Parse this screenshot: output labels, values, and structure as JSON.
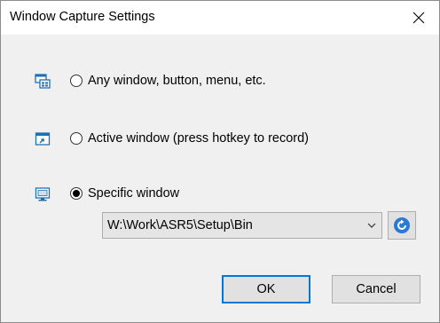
{
  "window": {
    "title": "Window Capture Settings"
  },
  "options": [
    {
      "icon": "window-elements-icon",
      "label": "Any window, button, menu, etc.",
      "checked": false
    },
    {
      "icon": "active-window-icon",
      "label": "Active window  (press hotkey to record)",
      "checked": false
    },
    {
      "icon": "monitor-icon",
      "label": "Specific window",
      "checked": true
    }
  ],
  "specific_window": {
    "path_value": "W:\\Work\\ASR5\\Setup\\Bin"
  },
  "buttons": {
    "ok_label": "OK",
    "cancel_label": "Cancel"
  },
  "colors": {
    "accent": "#0078d7",
    "icon_blue": "#1f6fb5",
    "refresh_blue": "#2b79d6"
  }
}
